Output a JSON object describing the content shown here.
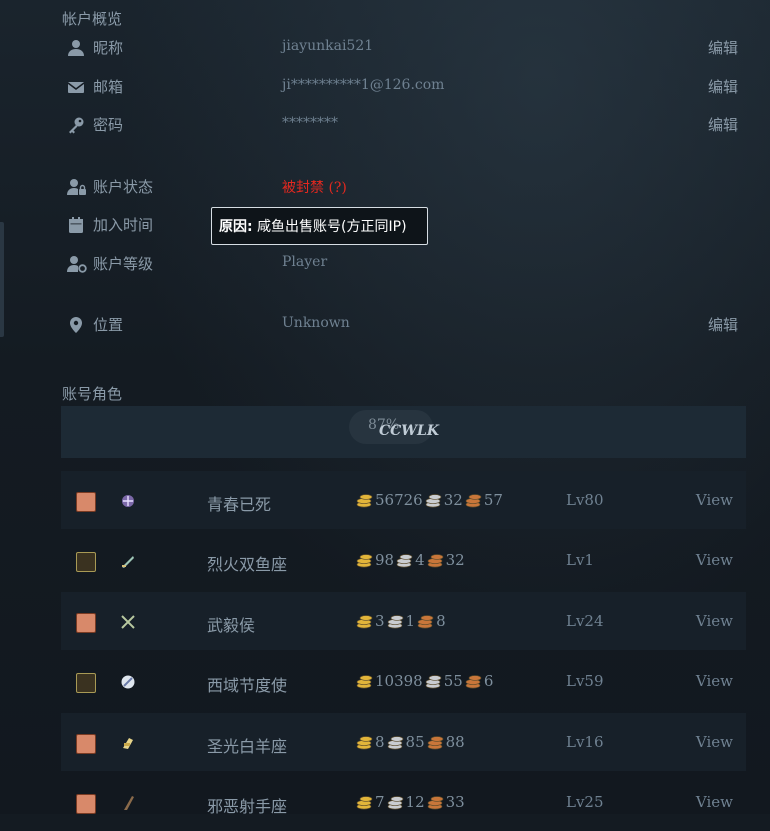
{
  "overview": {
    "title": "帐户概览",
    "rows": {
      "nickname": {
        "label": "昵称",
        "value": "jiayunkai521",
        "edit": "编辑"
      },
      "email": {
        "label": "邮箱",
        "value": "ji**********1@126.com",
        "edit": "编辑"
      },
      "password": {
        "label": "密码",
        "value": "********",
        "edit": "编辑"
      },
      "status": {
        "label": "账户状态",
        "value": "被封禁 (?)"
      },
      "joined": {
        "label": "加入时间"
      },
      "level": {
        "label": "账户等级",
        "value": "Player"
      },
      "location": {
        "label": "位置",
        "value": "Unknown",
        "edit": "编辑"
      }
    },
    "tooltip": {
      "reason_label": "原因:",
      "reason_text": " 咸鱼出售账号(方正同IP)"
    }
  },
  "characters": {
    "title": "账号角色",
    "loading": {
      "percent_text": "87%",
      "realm_text": "CCWLK",
      "progress": 0.87
    },
    "list": [
      {
        "race_icon": "human-female-icon",
        "class_icon": "warlock-icon",
        "name": "青春已死",
        "gold": "56726",
        "silver": "32",
        "copper": "57",
        "level": "Lv80",
        "view": "View"
      },
      {
        "race_icon": "undead-icon",
        "class_icon": "warrior-icon",
        "name": "烈火双鱼座",
        "gold": "98",
        "silver": "4",
        "copper": "32",
        "level": "Lv1",
        "view": "View"
      },
      {
        "race_icon": "human-female-icon",
        "class_icon": "rogue-icon",
        "name": "武毅侯",
        "gold": "3",
        "silver": "1",
        "copper": "8",
        "level": "Lv24",
        "view": "View"
      },
      {
        "race_icon": "undead-icon",
        "class_icon": "mage-icon",
        "name": "西域节度使",
        "gold": "10398",
        "silver": "55",
        "copper": "6",
        "level": "Lv59",
        "view": "View"
      },
      {
        "race_icon": "human-female-icon",
        "class_icon": "paladin-icon",
        "name": "圣光白羊座",
        "gold": "8",
        "silver": "85",
        "copper": "88",
        "level": "Lv16",
        "view": "View"
      },
      {
        "race_icon": "human-female-icon",
        "class_icon": "hunter-icon",
        "name": "邪恶射手座",
        "gold": "7",
        "silver": "12",
        "copper": "33",
        "level": "Lv25",
        "view": "View"
      }
    ]
  },
  "colors": {
    "gold": "#e2b53a",
    "silver": "#c9ccd0",
    "copper": "#c8763a",
    "banned": "#e3281f"
  }
}
